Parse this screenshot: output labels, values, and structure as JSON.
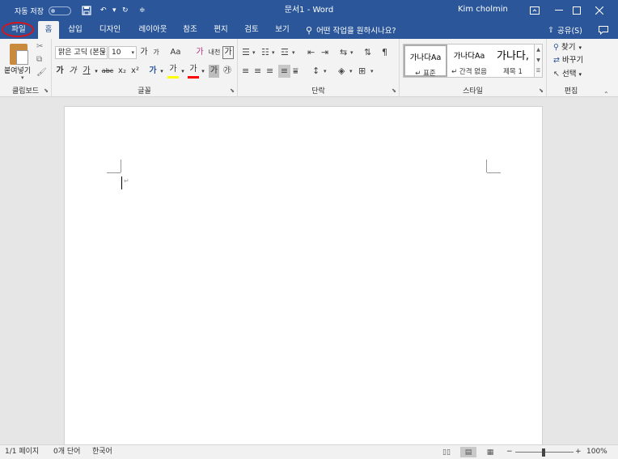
{
  "titlebar": {
    "autosave_label": "자동 저장",
    "autosave_state": "끔",
    "doc_title": "문서1  -  Word",
    "user_name": "Kim cholmin",
    "icons": [
      "save-icon",
      "undo-icon",
      "redo-icon",
      "customize-qat-icon"
    ]
  },
  "tabs": [
    {
      "label": "파일",
      "active": false
    },
    {
      "label": "홈",
      "active": true
    },
    {
      "label": "삽입",
      "active": false
    },
    {
      "label": "디자인",
      "active": false
    },
    {
      "label": "레이아웃",
      "active": false
    },
    {
      "label": "참조",
      "active": false
    },
    {
      "label": "편지",
      "active": false
    },
    {
      "label": "검토",
      "active": false
    },
    {
      "label": "보기",
      "active": false
    }
  ],
  "tell_me": {
    "placeholder": "어떤 작업을 원하시나요?"
  },
  "share": {
    "label": "공유(S)"
  },
  "ribbon": {
    "clipboard": {
      "label": "클립보드",
      "paste_label": "붙여넣기"
    },
    "font": {
      "label": "글꼴",
      "font_name": "맑은 고딕 (본문)",
      "font_size": "10",
      "grow": "가",
      "shrink": "가",
      "case": "Aa",
      "clear": "가",
      "phonetic": "내천",
      "border": "가",
      "bold": "가",
      "italic": "가",
      "underline": "가",
      "strike": "abc",
      "subscript": "x₂",
      "superscript": "x²",
      "text_effect": "가",
      "highlight": "가",
      "font_color": "가",
      "shading": "가",
      "enclose": "㉮"
    },
    "paragraph": {
      "label": "단락"
    },
    "styles": {
      "label": "스타일",
      "items": [
        {
          "sample": "가나다Aa",
          "name": "↵ 표준",
          "selected": true
        },
        {
          "sample": "가나다Aa",
          "name": "↵ 간격 없음",
          "selected": false
        },
        {
          "sample": "가나다,",
          "name": "제목 1",
          "selected": false
        }
      ]
    },
    "editing": {
      "label": "편집",
      "find": "찾기",
      "replace": "바꾸기",
      "select": "선택"
    }
  },
  "statusbar": {
    "page": "1/1 페이지",
    "words": "0개 단어",
    "language": "한국어",
    "zoom": "100%",
    "zoom_minus": "−",
    "zoom_plus": "+"
  },
  "colors": {
    "accent": "#2b579a",
    "highlight_bar": "#ffff00",
    "font_color_bar": "#ff0000",
    "annotation_circle": "#d4151d"
  }
}
